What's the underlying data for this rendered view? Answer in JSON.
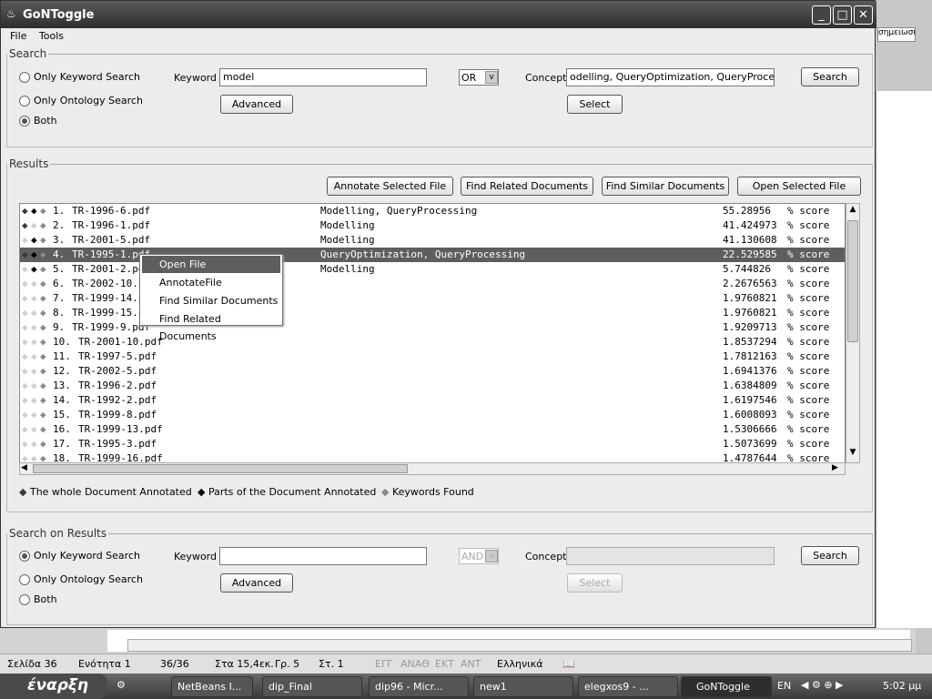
{
  "window": {
    "title": "GoNToggle"
  },
  "menu": [
    "File",
    "Tools"
  ],
  "search": {
    "legend": "Search",
    "radios": [
      {
        "label": "Only Keyword Search",
        "checked": false
      },
      {
        "label": "Only Ontology Search",
        "checked": false
      },
      {
        "label": "Both",
        "checked": true
      }
    ],
    "keyword_label": "Keyword",
    "keyword_value": "model",
    "operator": "OR",
    "concept_label": "Concept",
    "concept_value": "odelling, QueryOptimization, QueryProcessing",
    "search_btn": "Search",
    "advanced_btn": "Advanced",
    "select_btn": "Select"
  },
  "results": {
    "legend": "Results",
    "buttons": [
      "Annotate Selected File",
      "Find Related Documents",
      "Find Similar Documents",
      "Open Selected File"
    ],
    "selected_index": 3,
    "rows": [
      {
        "n": "1.",
        "file": "TR-1996-6.pdf",
        "concepts": "Modelling, QueryProcessing",
        "score": "55.28956",
        "d": [
          "whole",
          "parts",
          "keywords"
        ]
      },
      {
        "n": "2.",
        "file": "TR-1996-1.pdf",
        "concepts": "Modelling",
        "score": "41.424973",
        "d": [
          "whole",
          "none",
          "keywords"
        ]
      },
      {
        "n": "3.",
        "file": "TR-2001-5.pdf",
        "concepts": "Modelling",
        "score": "41.130608",
        "d": [
          "none",
          "parts",
          "keywords"
        ]
      },
      {
        "n": "4.",
        "file": "TR-1995-1.pdf",
        "concepts": "QueryOptimization, QueryProcessing",
        "score": "22.529585",
        "d": [
          "whole",
          "parts",
          "keywords"
        ]
      },
      {
        "n": "5.",
        "file": "TR-2001-2.pdf",
        "concepts": "Modelling",
        "score": "5.744826",
        "d": [
          "none",
          "parts",
          "keywords"
        ]
      },
      {
        "n": "6.",
        "file": "TR-2002-10.pdf",
        "concepts": "",
        "score": "2.2676563",
        "d": [
          "none",
          "none",
          "keywords"
        ]
      },
      {
        "n": "7.",
        "file": "TR-1999-14.pdf",
        "concepts": "",
        "score": "1.9760821",
        "d": [
          "none",
          "none",
          "keywords"
        ]
      },
      {
        "n": "8.",
        "file": "TR-1999-15.pdf",
        "concepts": "",
        "score": "1.9760821",
        "d": [
          "none",
          "none",
          "keywords"
        ]
      },
      {
        "n": "9.",
        "file": "TR-1999-9.pdf",
        "concepts": "",
        "score": "1.9209713",
        "d": [
          "none",
          "none",
          "keywords"
        ]
      },
      {
        "n": "10.",
        "file": "TR-2001-10.pdf",
        "concepts": "",
        "score": "1.8537294",
        "d": [
          "none",
          "none",
          "keywords"
        ]
      },
      {
        "n": "11.",
        "file": "TR-1997-5.pdf",
        "concepts": "",
        "score": "1.7812163",
        "d": [
          "none",
          "none",
          "keywords"
        ]
      },
      {
        "n": "12.",
        "file": "TR-2002-5.pdf",
        "concepts": "",
        "score": "1.6941376",
        "d": [
          "none",
          "none",
          "keywords"
        ]
      },
      {
        "n": "13.",
        "file": "TR-1996-2.pdf",
        "concepts": "",
        "score": "1.6384809",
        "d": [
          "none",
          "none",
          "keywords"
        ]
      },
      {
        "n": "14.",
        "file": "TR-1992-2.pdf",
        "concepts": "",
        "score": "1.6197546",
        "d": [
          "none",
          "none",
          "keywords"
        ]
      },
      {
        "n": "15.",
        "file": "TR-1999-8.pdf",
        "concepts": "",
        "score": "1.6008093",
        "d": [
          "none",
          "none",
          "keywords"
        ]
      },
      {
        "n": "16.",
        "file": "TR-1999-13.pdf",
        "concepts": "",
        "score": "1.5306666",
        "d": [
          "none",
          "none",
          "keywords"
        ]
      },
      {
        "n": "17.",
        "file": "TR-1995-3.pdf",
        "concepts": "",
        "score": "1.5073699",
        "d": [
          "none",
          "none",
          "keywords"
        ]
      },
      {
        "n": "18.",
        "file": "TR-1999-16.pdf",
        "concepts": "",
        "score": "1.4787644",
        "d": [
          "none",
          "none",
          "keywords"
        ]
      }
    ],
    "score_suffix": "% score",
    "legend_items": [
      {
        "label": "The whole Document Annotated",
        "kind": "whole"
      },
      {
        "label": "Parts of the Document Annotated",
        "kind": "parts"
      },
      {
        "label": "Keywords Found",
        "kind": "keywords"
      }
    ],
    "colors": {
      "whole": "#3a3a3a",
      "parts": "#000000",
      "keywords": "#8a8a8a",
      "none": "#cfcfcf"
    }
  },
  "context_menu": {
    "items": [
      "Open File",
      "AnnotateFile",
      "Find Similar Documents",
      "Find Related Documents"
    ],
    "highlighted": 0
  },
  "sor": {
    "legend": "Search on Results",
    "radios": [
      {
        "label": "Only Keyword Search",
        "checked": true
      },
      {
        "label": "Only Ontology Search",
        "checked": false
      },
      {
        "label": "Both",
        "checked": false
      }
    ],
    "keyword_label": "Keyword",
    "keyword_value": "",
    "operator": "AND",
    "concept_label": "Concept",
    "concept_value": "",
    "search_btn": "Search",
    "advanced_btn": "Advanced",
    "select_btn": "Select"
  },
  "bg": {
    "dropdown": "σημειωση",
    "status": [
      "Σελίδα 36",
      "Ενότητα 1",
      "36/36",
      "Στα 15,4εκ.",
      "Γρ. 5",
      "Στ. 1",
      "ΕΓΓ",
      "ΑΝΑΘ",
      "ΕΚΤ",
      "ΑΝΤ",
      "Ελληνικά"
    ]
  },
  "taskbar": {
    "start": "έναρξη",
    "items": [
      "NetBeans I...",
      "dip_Final",
      "dip96 - Micr...",
      "new1",
      "elegxos9 - ...",
      "GoNToggle"
    ],
    "lang": "EN",
    "clock": "5:02 μμ"
  }
}
